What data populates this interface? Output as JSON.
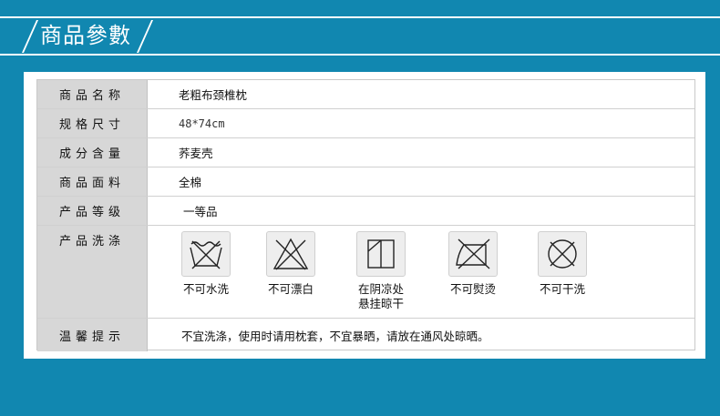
{
  "header": {
    "title": "商品參數"
  },
  "specs": [
    {
      "label": "商品名称",
      "value": "老粗布颈椎枕"
    },
    {
      "label": "规格尺寸",
      "value": "48*74cm"
    },
    {
      "label": "成分含量",
      "value": "荞麦壳"
    },
    {
      "label": "商品面料",
      "value": "全棉"
    },
    {
      "label": "产品等级",
      "value": "一等品"
    }
  ],
  "care": {
    "label": "产品洗涤",
    "items": [
      {
        "icon": "no-wash-icon",
        "label": "不可水洗"
      },
      {
        "icon": "no-bleach-icon",
        "label": "不可漂白"
      },
      {
        "icon": "line-dry-shade-icon",
        "label_line1": "在阴凉处",
        "label_line2": "悬挂晾干"
      },
      {
        "icon": "no-iron-icon",
        "label": "不可熨烫"
      },
      {
        "icon": "no-dry-clean-icon",
        "label": "不可干洗"
      }
    ]
  },
  "notice": {
    "label": "温馨提示",
    "value": "不宜洗涤，使用时请用枕套，不宜暴晒，请放在通风处晾晒。"
  }
}
